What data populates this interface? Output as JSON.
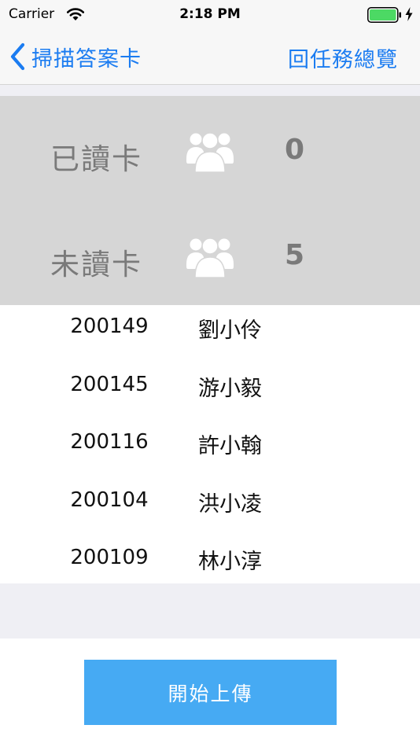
{
  "status_bar": {
    "carrier": "Carrier",
    "time": "2:18 PM",
    "icons": [
      "wifi-icon",
      "battery-icon",
      "charging-bolt-icon"
    ],
    "battery_color": "#4cd964"
  },
  "nav": {
    "back_label": "掃描答案卡",
    "back_icon": "chevron-left-icon",
    "right_label": "回任務總覽",
    "accent_color": "#1b7cf1"
  },
  "summary": {
    "read": {
      "label": "已讀卡",
      "count": "0",
      "icon": "people-icon"
    },
    "unread": {
      "label": "未讀卡",
      "count": "5",
      "icon": "people-icon"
    }
  },
  "students": [
    {
      "id": "200149",
      "name": "劉小伶"
    },
    {
      "id": "200145",
      "name": "游小毅"
    },
    {
      "id": "200116",
      "name": "許小翰"
    },
    {
      "id": "200104",
      "name": "洪小凌"
    },
    {
      "id": "200109",
      "name": "林小淳"
    }
  ],
  "upload": {
    "label": "開始上傳",
    "color": "#46aaf3"
  }
}
